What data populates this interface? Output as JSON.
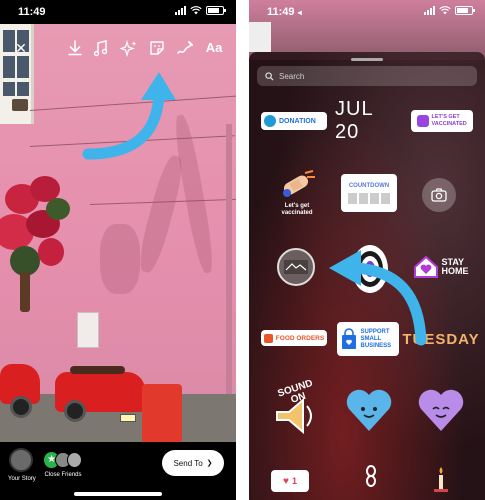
{
  "left": {
    "status_time": "11:49",
    "toolbar": {
      "close": "✕",
      "download": "download",
      "music": "music",
      "effects": "effects",
      "sticker": "sticker",
      "draw": "draw",
      "text": "Aa"
    },
    "share": {
      "your_story_label": "Your Story",
      "close_friends_label": "Close Friends",
      "send_to_label": "Send To",
      "send_to_chevron": "❯"
    }
  },
  "right": {
    "status_time": "11:49",
    "status_back": "◂",
    "search_placeholder": "Search",
    "stickers": {
      "donation": "DONATION",
      "date": "JUL 20",
      "vaccinated": "LET'S GET VACCINATED",
      "lets_get_vaccinated_small": "Let's get vaccinated",
      "countdown": "COUNTDOWN",
      "stay_home": "STAY HOME",
      "food_orders": "FOOD ORDERS",
      "support_small_business": "SUPPORT SMALL BUSINESS",
      "tuesday": "TUESDAY",
      "sound_on": "SOUND ON",
      "like_count": "1"
    }
  },
  "colors": {
    "arrow": "#3fb4ea",
    "wall_pink": "#e693b0",
    "tray_bg": "#2a1418"
  }
}
